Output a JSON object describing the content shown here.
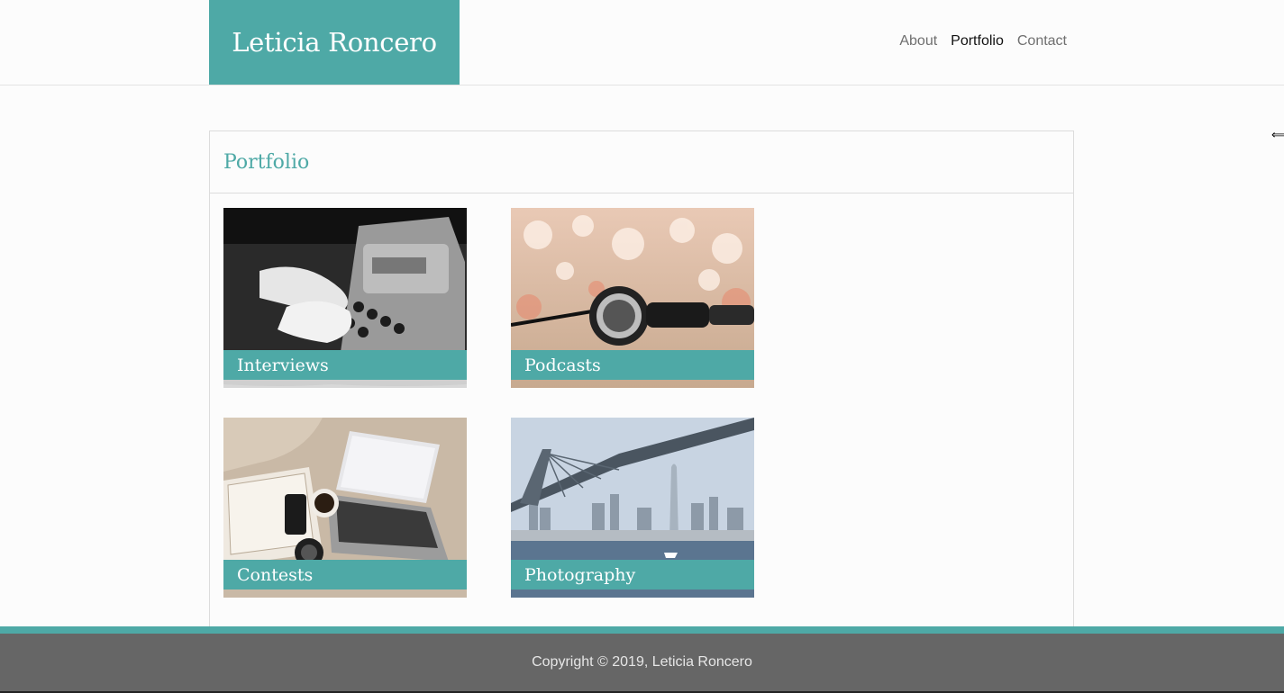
{
  "header": {
    "logo_text": "Leticia Roncero",
    "nav": [
      {
        "label": "About",
        "active": false
      },
      {
        "label": "Portfolio",
        "active": true
      },
      {
        "label": "Contact",
        "active": false
      }
    ]
  },
  "portfolio": {
    "title": "Portfolio",
    "cards": [
      {
        "label": "Interviews",
        "image": "typewriter-photo"
      },
      {
        "label": "Podcasts",
        "image": "headphones-photo"
      },
      {
        "label": "Contests",
        "image": "laptop-desk-photo"
      },
      {
        "label": "Photography",
        "image": "bay-bridge-photo"
      }
    ]
  },
  "footer": {
    "copyright": "Copyright © 2019, Leticia Roncero"
  },
  "cursor": {
    "icon": "resize-horizontal-cursor-icon",
    "glyph": "⟺"
  },
  "colors": {
    "accent": "#4ea9a6",
    "footer_bg": "#666666",
    "background": "#fcfcfc"
  }
}
